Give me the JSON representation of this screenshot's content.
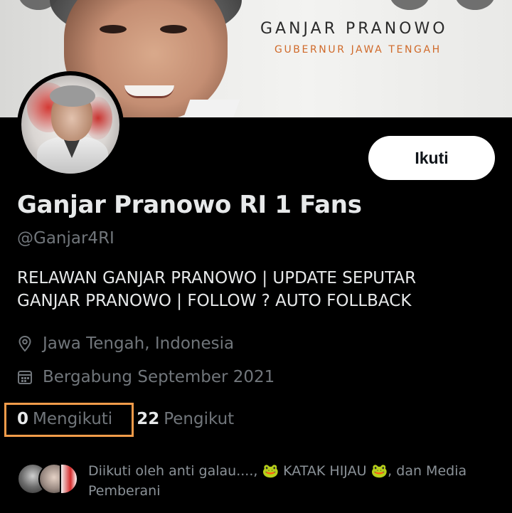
{
  "banner": {
    "title": "GANJAR PRANOWO",
    "subtitle": "GUBERNUR JAWA TENGAH"
  },
  "profile": {
    "name": "Ganjar Pranowo RI 1 Fans",
    "handle": "@Ganjar4RI",
    "bio_line1": "RELAWAN GANJAR PRANOWO | UPDATE SEPUTAR",
    "bio_line2": "GANJAR PRANOWO | FOLLOW ? AUTO FOLLBACK",
    "location": "Jawa Tengah, Indonesia",
    "joined": "Bergabung September 2021"
  },
  "actions": {
    "follow_label": "Ikuti"
  },
  "stats": {
    "following_count": "0",
    "following_label": "Mengikuti",
    "followers_count": "22",
    "followers_label": "Pengikut"
  },
  "followed_by": {
    "text": "Diikuti oleh anti galau...., 🐸 KATAK HIJAU 🐸, dan Media Pemberani"
  },
  "icons": {
    "location": "location-pin-icon",
    "calendar": "calendar-icon"
  },
  "colors": {
    "background": "#000000",
    "primary_text": "#e7e9ea",
    "secondary_text": "#71767b",
    "highlight": "#f39c4a",
    "banner_subtitle": "#d06a2a"
  }
}
